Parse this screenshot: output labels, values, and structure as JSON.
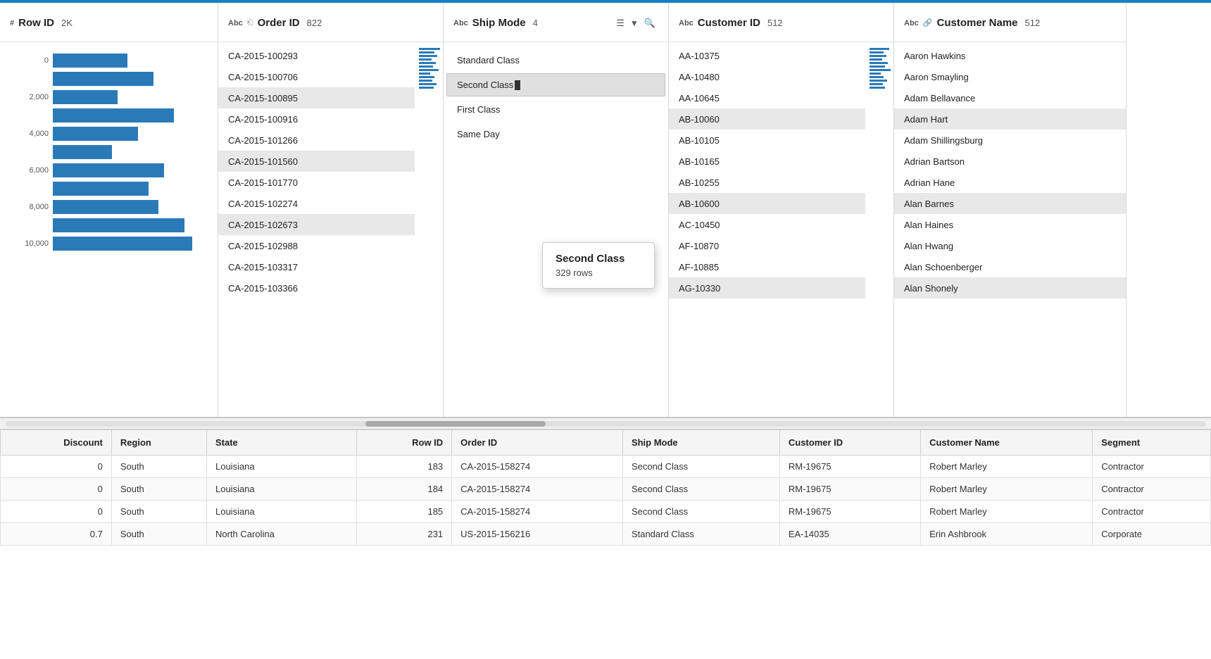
{
  "topBar": {},
  "columns": {
    "rowId": {
      "typeIcon": "#",
      "title": "Row ID",
      "count": "2K",
      "histogramBars": [
        {
          "label": "0",
          "widthPct": 48
        },
        {
          "label": "",
          "widthPct": 65
        },
        {
          "label": "2,000",
          "widthPct": 42
        },
        {
          "label": "",
          "widthPct": 78
        },
        {
          "label": "4,000",
          "widthPct": 55
        },
        {
          "label": "",
          "widthPct": 38
        },
        {
          "label": "6,000",
          "widthPct": 72
        },
        {
          "label": "",
          "widthPct": 62
        },
        {
          "label": "8,000",
          "widthPct": 68
        },
        {
          "label": "",
          "widthPct": 85
        },
        {
          "label": "10,000",
          "widthPct": 90
        }
      ]
    },
    "orderId": {
      "typeIcon": "Abc",
      "filterIcon": true,
      "title": "Order ID",
      "count": "822",
      "values": [
        "CA-2015-100293",
        "CA-2015-100706",
        "CA-2015-100895",
        "CA-2015-100916",
        "CA-2015-101266",
        "CA-2015-101560",
        "CA-2015-101770",
        "CA-2015-102274",
        "CA-2015-102673",
        "CA-2015-102988",
        "CA-2015-103317",
        "CA-2015-103366"
      ]
    },
    "shipMode": {
      "typeIcon": "Abc",
      "title": "Ship Mode",
      "count": "4",
      "hasDropdown": true,
      "hasSort": true,
      "hasSearch": true,
      "items": [
        {
          "label": "Standard Class",
          "selected": false
        },
        {
          "label": "Second Class",
          "selected": true
        },
        {
          "label": "First Class",
          "selected": false
        },
        {
          "label": "Same Day",
          "selected": false
        }
      ],
      "tooltip": {
        "title": "Second Class",
        "subtitle": "329 rows"
      }
    },
    "customerId": {
      "typeIcon": "Abc",
      "title": "Customer ID",
      "count": "512",
      "values": [
        "AA-10375",
        "AA-10480",
        "AA-10645",
        "AB-10060",
        "AB-10105",
        "AB-10165",
        "AB-10255",
        "AB-10600",
        "AC-10450",
        "AF-10870",
        "AF-10885",
        "AG-10330"
      ]
    },
    "customerName": {
      "typeIcon": "Abc",
      "linkIcon": true,
      "title": "Customer Name",
      "count": "512",
      "values": [
        "Aaron Hawkins",
        "Aaron Smayling",
        "Adam Bellavance",
        "Adam Hart",
        "Adam Shillingsburg",
        "Adrian Bartson",
        "Adrian Hane",
        "Alan Barnes",
        "Alan Haines",
        "Alan Hwang",
        "Alan Schoenberger",
        "Alan Shonely"
      ]
    }
  },
  "bottomTable": {
    "headers": [
      "Discount",
      "Region",
      "State",
      "Row ID",
      "Order ID",
      "Ship Mode",
      "Customer ID",
      "Customer Name",
      "Segment"
    ],
    "rows": [
      {
        "discount": "0",
        "region": "South",
        "state": "Louisiana",
        "rowId": "183",
        "orderId": "CA-2015-158274",
        "shipMode": "Second Class",
        "customerId": "RM-19675",
        "customerName": "Robert Marley",
        "segment": "Contractor"
      },
      {
        "discount": "0",
        "region": "South",
        "state": "Louisiana",
        "rowId": "184",
        "orderId": "CA-2015-158274",
        "shipMode": "Second Class",
        "customerId": "RM-19675",
        "customerName": "Robert Marley",
        "segment": "Contractor"
      },
      {
        "discount": "0",
        "region": "South",
        "state": "Louisiana",
        "rowId": "185",
        "orderId": "CA-2015-158274",
        "shipMode": "Second Class",
        "customerId": "RM-19675",
        "customerName": "Robert Marley",
        "segment": "Contractor"
      },
      {
        "discount": "0.7",
        "region": "South",
        "state": "North Carolina",
        "rowId": "231",
        "orderId": "US-2015-156216",
        "shipMode": "Standard Class",
        "customerId": "EA-14035",
        "customerName": "Erin Ashbrook",
        "segment": "Corporate"
      }
    ]
  }
}
